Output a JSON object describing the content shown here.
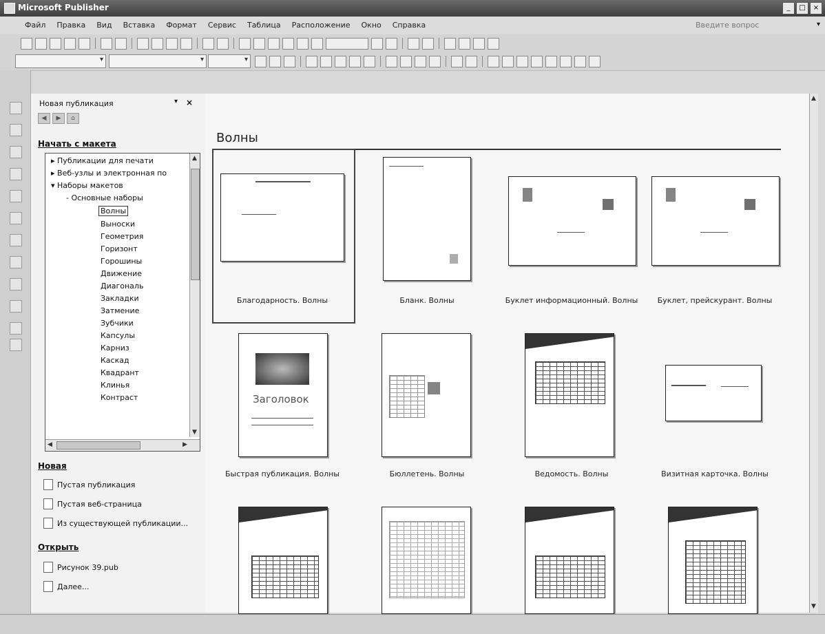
{
  "window": {
    "title": "Microsoft Publisher"
  },
  "menu": [
    "Файл",
    "Правка",
    "Вид",
    "Вставка",
    "Формат",
    "Сервис",
    "Таблица",
    "Расположение",
    "Окно",
    "Справка"
  ],
  "ask_placeholder": "Введите вопрос",
  "pane": {
    "title": "Новая публикация",
    "start_section": "Начать с макета",
    "tree": [
      {
        "label": "Публикации для печати",
        "level": 1
      },
      {
        "label": "Веб-узлы и электронная по",
        "level": 1
      },
      {
        "label": "Наборы макетов",
        "level": 1
      },
      {
        "label": "Основные наборы",
        "level": 2
      },
      {
        "label": "Волны",
        "level": 3,
        "selected": true
      },
      {
        "label": "Выноски",
        "level": 3
      },
      {
        "label": "Геометрия",
        "level": 3
      },
      {
        "label": "Горизонт",
        "level": 3
      },
      {
        "label": "Горошины",
        "level": 3
      },
      {
        "label": "Движение",
        "level": 3
      },
      {
        "label": "Диагональ",
        "level": 3
      },
      {
        "label": "Закладки",
        "level": 3
      },
      {
        "label": "Затмение",
        "level": 3
      },
      {
        "label": "Зубчики",
        "level": 3
      },
      {
        "label": "Капсулы",
        "level": 3
      },
      {
        "label": "Карниз",
        "level": 3
      },
      {
        "label": "Каскад",
        "level": 3
      },
      {
        "label": "Квадрант",
        "level": 3
      },
      {
        "label": "Клинья",
        "level": 3
      },
      {
        "label": "Контраст",
        "level": 3
      }
    ],
    "new_section": "Новая",
    "new_items": [
      "Пустая публикация",
      "Пустая веб-страница",
      "Из существующей публикации..."
    ],
    "open_section": "Открыть",
    "open_items": [
      "Рисунок 39.pub",
      "Далее..."
    ]
  },
  "main": {
    "heading": "Волны",
    "templates": [
      "Благодарность. Волны",
      "Бланк. Волны",
      "Буклет информационный. Волны",
      "Буклет, прейскурант. Волны",
      "Быстрая публикация. Волны",
      "Бюллетень. Волны",
      "Ведомость. Волны",
      "Визитная карточка. Волны"
    ],
    "zagolovok": "Заголовок"
  }
}
